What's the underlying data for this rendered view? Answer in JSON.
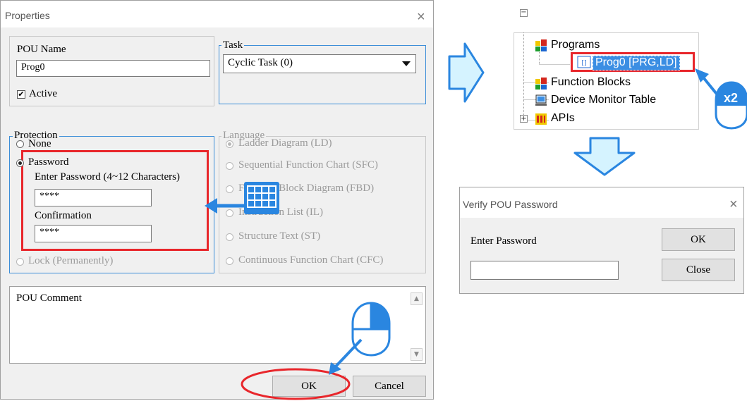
{
  "properties": {
    "title": "Properties",
    "close_glyph": "×",
    "pou_name_label": "POU Name",
    "pou_name_value": "Prog0",
    "active_label": "Active",
    "active_check_glyph": "✔",
    "task_label": "Task",
    "task_value": "Cyclic Task (0)",
    "protection_label": "Protection",
    "none_label": "None",
    "password_label": "Password",
    "enter_password_label": "Enter Password (4~12 Characters)",
    "password_value": "****",
    "confirmation_label": "Confirmation",
    "confirmation_value": "****",
    "lock_label": "Lock (Permanently)",
    "language_label": "Language",
    "languages": [
      "Ladder Diagram (LD)",
      "Sequential Function Chart (SFC)",
      "Function Block Diagram (FBD)",
      "Instruction List (IL)",
      "Structure Text (ST)",
      "Continuous Function Chart (CFC)"
    ],
    "comment_label": "POU Comment",
    "ok_label": "OK",
    "cancel_label": "Cancel"
  },
  "tree": {
    "expander_minus": "−",
    "expander_plus": "+",
    "programs_label": "Programs",
    "prog0_label": "Prog0 [PRG,LD]",
    "function_blocks_label": "Function Blocks",
    "device_monitor_label": "Device Monitor Table",
    "apis_label": "APIs"
  },
  "annotation": {
    "double_click_badge": "x2"
  },
  "verify": {
    "title": "Verify POU Password",
    "close_glyph": "×",
    "enter_password_label": "Enter Password",
    "password_value": "",
    "ok_label": "OK",
    "close_label": "Close"
  },
  "colors": {
    "highlight_red": "#e8262b",
    "group_blue": "#3c8ed8",
    "arrow_cyan": "#d5f3ff",
    "arrow_blue": "#2a86e0",
    "selection_blue": "#3b8ee3"
  }
}
